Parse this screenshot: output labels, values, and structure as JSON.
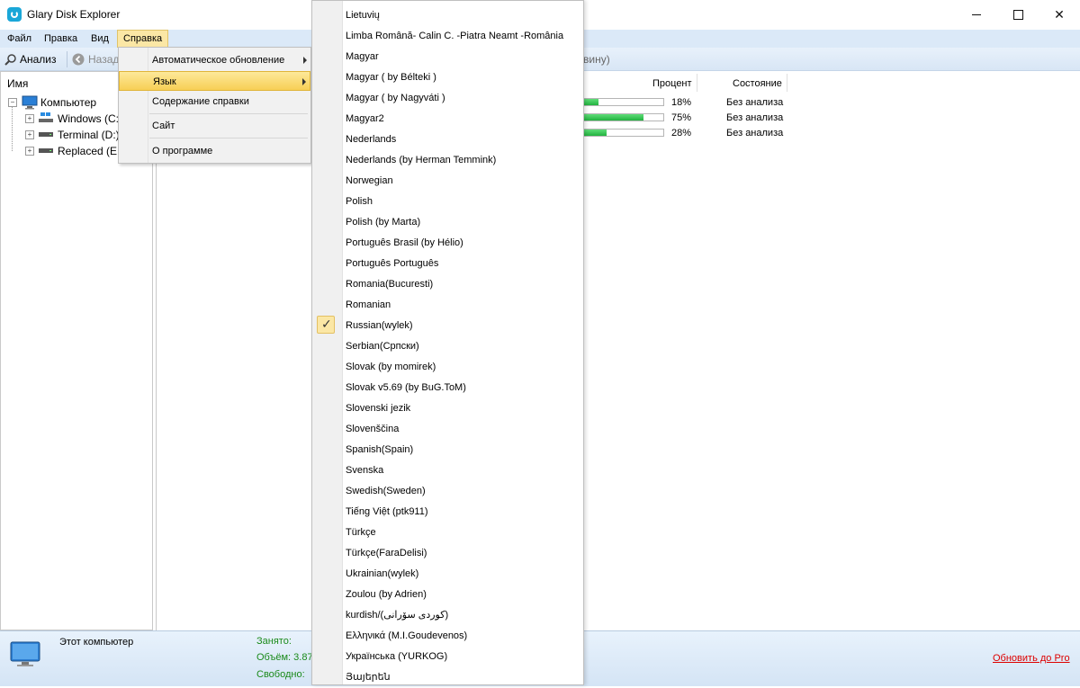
{
  "window": {
    "title": "Glary Disk Explorer"
  },
  "menubar": {
    "items": [
      "Файл",
      "Правка",
      "Вид",
      "Справка"
    ]
  },
  "toolbar": {
    "analyze": "Анализ",
    "back": "Назад",
    "path_tail": "вину)"
  },
  "tree": {
    "header": "Имя",
    "root": "Компьютер",
    "drives": [
      "Windows (C:",
      "Terminal (D:)",
      "Replaced (E:)"
    ]
  },
  "table": {
    "columns": {
      "percent": "Процент",
      "state": "Состояние"
    },
    "rows": [
      {
        "percent_text": "18%",
        "fill": 0.18,
        "state": "Без анализа"
      },
      {
        "percent_text": "75%",
        "fill": 0.75,
        "state": "Без анализа"
      },
      {
        "percent_text": "28%",
        "fill": 0.28,
        "state": "Без анализа"
      }
    ]
  },
  "status": {
    "title": "Этот компьютер",
    "used": "Занято:",
    "volume": "Объём: 3.87",
    "free": "Свободно:",
    "upgrade": "Обновить до Pro"
  },
  "submenu": {
    "items": [
      "Автоматическое обновление",
      "Язык",
      "Содержание справки",
      "Сайт",
      "О программе"
    ]
  },
  "languages": {
    "selected": "Russian(wylek)",
    "items": [
      "Lietuvių",
      "Limba Română- Calin C. -Piatra Neamt -România",
      "Magyar",
      "Magyar ( by Bélteki )",
      "Magyar ( by Nagyváti )",
      "Magyar2",
      "Nederlands",
      "Nederlands (by Herman Temmink)",
      "Norwegian",
      "Polish",
      "Polish (by Marta)",
      "Português Brasil (by Hélio)",
      "Português Português",
      "Romania(Bucuresti)",
      "Romanian",
      "Russian(wylek)",
      "Serbian(Српски)",
      "Slovak (by momirek)",
      "Slovak v5.69 (by BuG.ToM)",
      "Slovenski jezik",
      "Slovenščina",
      "Spanish(Spain)",
      "Svenska",
      "Swedish(Sweden)",
      "Tiếng Việt (ptk911)",
      "Türkçe",
      "Türkçe(FaraDelisi)",
      "Ukrainian(wylek)",
      "Zoulou (by Adrien)",
      "kurdish/(کوردی سۆرانی)",
      "Ελληνικά (M.I.Goudevenos)",
      "Українська (YURKOG)",
      "Յայերեն"
    ]
  }
}
